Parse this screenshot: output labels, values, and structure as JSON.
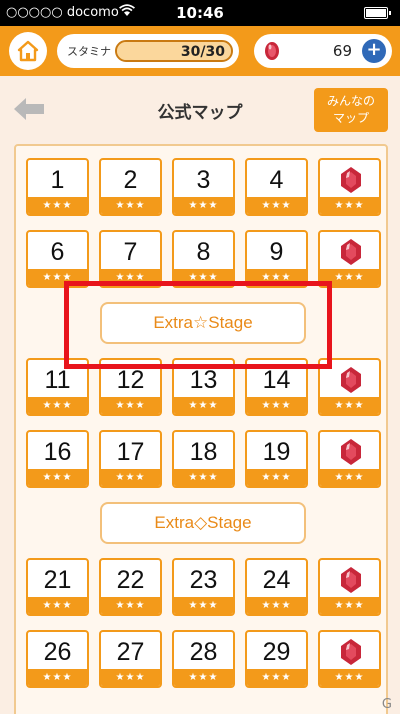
{
  "status_bar": {
    "carrier": "○○○○○ docomo",
    "time": "10:46"
  },
  "header": {
    "stamina_label": "スタミナ",
    "stamina_value": "30/30",
    "stamina_fraction": 1.0,
    "gem_count": "69",
    "plus_label": "+"
  },
  "title": {
    "text": "公式マップ",
    "everyone_button": "みんなの\nマップ"
  },
  "stars": "★★★",
  "stages_rows": [
    [
      "1",
      "2",
      "3",
      "4"
    ],
    [
      "6",
      "7",
      "8",
      "9"
    ],
    [
      "11",
      "12",
      "13",
      "14"
    ],
    [
      "16",
      "17",
      "18",
      "19"
    ],
    [
      "21",
      "22",
      "23",
      "24"
    ],
    [
      "26",
      "27",
      "28",
      "29"
    ]
  ],
  "extra_buttons": [
    "Extra☆Stage",
    "Extra◇Stage"
  ],
  "colors": {
    "accent": "#f39a1a",
    "highlight": "#e8141c",
    "gem": "#c8273a"
  },
  "watermark": "G"
}
